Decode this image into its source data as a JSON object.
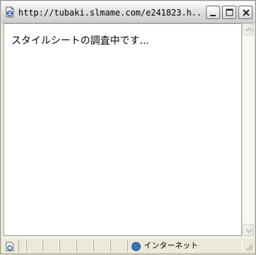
{
  "window": {
    "title": "http://tubaki.slmame.com/e241823.h..."
  },
  "page": {
    "message": "スタイルシートの調査中です..."
  },
  "statusbar": {
    "zone_label": "インターネット"
  },
  "icons": {
    "app": "ie-page-icon",
    "status_page": "page-icon",
    "zone": "globe-icon"
  },
  "colors": {
    "title_bg": "#e8e8e8",
    "content_bg": "#ffffff",
    "statusbar_bg": "#ece9d8"
  }
}
